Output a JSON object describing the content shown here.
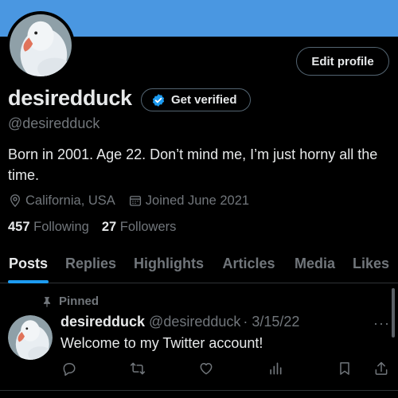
{
  "header": {
    "banner_color": "#4a97e1"
  },
  "profile": {
    "avatar_icon": "white-goose-avatar",
    "edit_profile_label": "Edit profile",
    "display_name": "desiredduck",
    "verify_label": "Get verified",
    "verify_icon": "verified-badge-icon",
    "handle": "@desiredduck",
    "bio": "Born in 2001. Age 22. Don’t mind me, I’m just horny all the time.",
    "location": "California, USA",
    "joined": "Joined June 2021",
    "following_count": "457",
    "following_label": "Following",
    "followers_count": "27",
    "followers_label": "Followers"
  },
  "tabs": [
    {
      "label": "Posts",
      "active": true
    },
    {
      "label": "Replies"
    },
    {
      "label": "Highlights"
    },
    {
      "label": "Articles"
    },
    {
      "label": "Media"
    },
    {
      "label": "Likes"
    }
  ],
  "pinned_tweet": {
    "pinned_label": "Pinned",
    "author_name": "desiredduck",
    "author_handle": "@desiredduck",
    "date": "· 3/15/22",
    "text": "Welcome to my Twitter account!",
    "more_label": "···",
    "actions": [
      "reply-icon",
      "retweet-icon",
      "like-icon",
      "views-icon",
      "bookmark-icon",
      "share-icon"
    ]
  },
  "colors": {
    "background": "#000000",
    "primary_text": "#e7e9ea",
    "secondary_text": "#71767b",
    "accent": "#1d9bf0",
    "border": "#2f3336"
  }
}
